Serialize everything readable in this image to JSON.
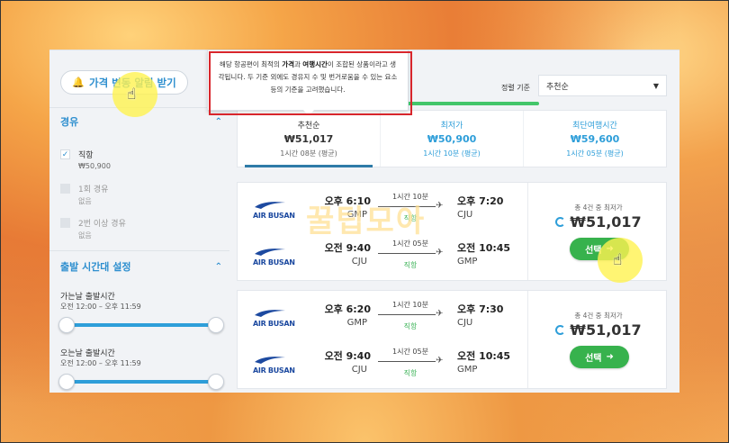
{
  "sidebar": {
    "alert_button": "가격 변동 알림 받기",
    "stops": {
      "title": "경유",
      "options": [
        {
          "label": "직항",
          "sub": "₩50,900",
          "checked": true,
          "disabled": false
        },
        {
          "label": "1회 경유",
          "sub": "없음",
          "checked": false,
          "disabled": true
        },
        {
          "label": "2번 이상 경유",
          "sub": "없음",
          "checked": false,
          "disabled": true
        }
      ]
    },
    "departure_time": {
      "title": "출발 시간대 설정",
      "outbound_label": "가는날 출발시간",
      "outbound_range": "오전 12:00 – 오후 11:59",
      "return_label": "오는날 출발시간",
      "return_range": "오전 12:00 – 오후 11:59"
    }
  },
  "sort": {
    "label": "정렬 기준",
    "selected": "추천순"
  },
  "tooltip": {
    "p1": "해당 항공편이 최적의 ",
    "b1": "가격",
    "p2": "과 ",
    "b2": "여행시간",
    "p3": "이 조합된 상품이라고 생각됩니다. 두 기준 외에도 경유지 수 및 번거로움을 수 있는 요소 등의 기준을 고려했습니다."
  },
  "tabs": [
    {
      "name": "추천순",
      "price": "₩51,017",
      "time": "1시간 08분 (평균)",
      "active": true
    },
    {
      "name": "최저가",
      "price": "₩50,900",
      "time": "1시간 10분 (평균)",
      "active": false
    },
    {
      "name": "최단여행시간",
      "price": "₩59,600",
      "time": "1시간 05분 (평균)",
      "active": false
    }
  ],
  "results": [
    {
      "legs": [
        {
          "airline": "AIR BUSAN",
          "dep_time": "오후 6:10",
          "dep_code": "GMP",
          "duration": "1시간 10분",
          "stops": "직항",
          "arr_time": "오후 7:20",
          "arr_code": "CJU"
        },
        {
          "airline": "AIR BUSAN",
          "dep_time": "오전 9:40",
          "dep_code": "CJU",
          "duration": "1시간 05분",
          "stops": "직항",
          "arr_time": "오전 10:45",
          "arr_code": "GMP"
        }
      ],
      "note": "총 4건 중 최저가",
      "price": "₩51,017",
      "select": "선택"
    },
    {
      "legs": [
        {
          "airline": "AIR BUSAN",
          "dep_time": "오후 6:20",
          "dep_code": "GMP",
          "duration": "1시간 10분",
          "stops": "직항",
          "arr_time": "오후 7:30",
          "arr_code": "CJU"
        },
        {
          "airline": "AIR BUSAN",
          "dep_time": "오전 9:40",
          "dep_code": "CJU",
          "duration": "1시간 05분",
          "stops": "직항",
          "arr_time": "오전 10:45",
          "arr_code": "GMP"
        }
      ],
      "note": "총 4건 중 최저가",
      "price": "₩51,017",
      "select": "선택"
    }
  ],
  "watermark": "꿀팁모아",
  "icons": {
    "bell": "bell-icon",
    "check": "check-icon",
    "chevron": "chevron-up-icon",
    "caret": "caret-down-icon",
    "plane": "airplane-icon",
    "arrow": "arrow-right-icon",
    "cursor": "hand-cursor-icon"
  },
  "colors": {
    "accent": "#2e9ed9",
    "direct": "#3fb45a",
    "select_button": "#37b24d",
    "highlight_box": "#d8262c"
  }
}
